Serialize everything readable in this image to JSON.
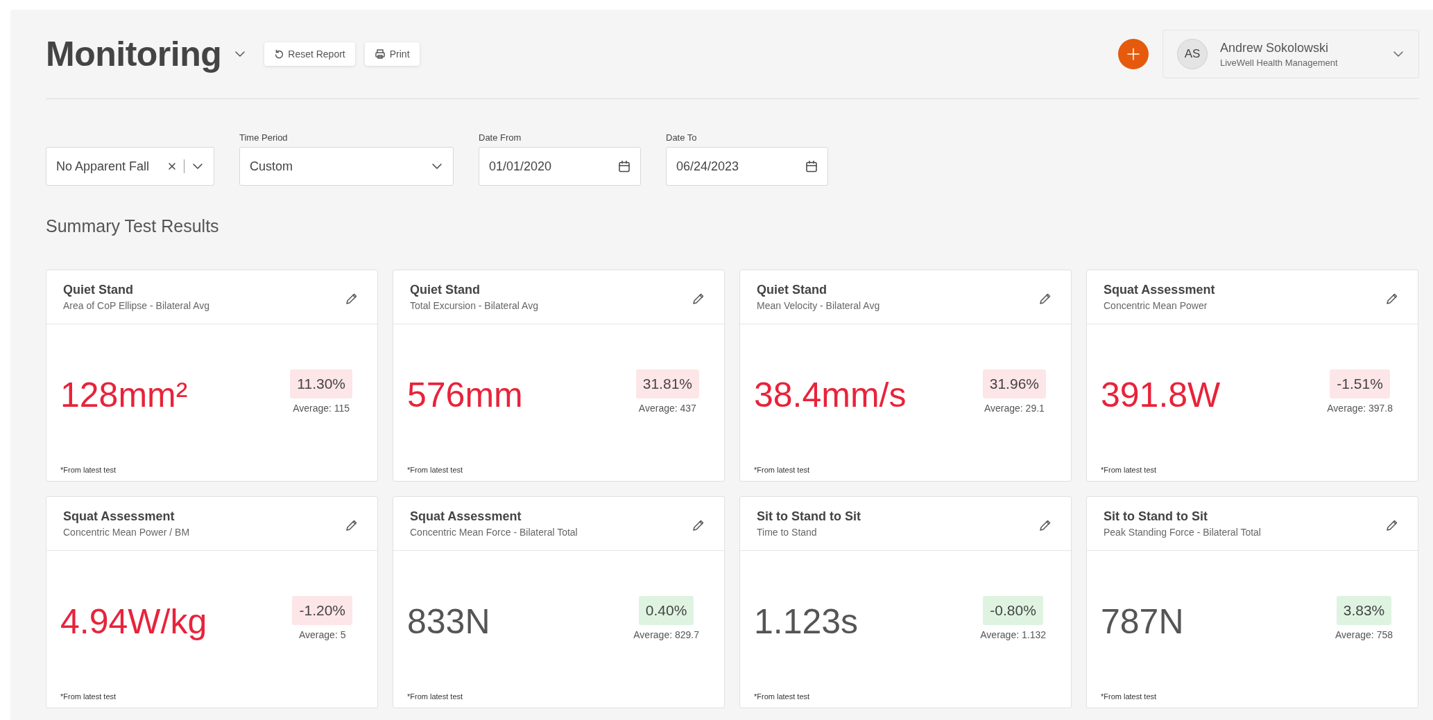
{
  "header": {
    "title": "Monitoring",
    "buttons": [
      {
        "kind": "reset",
        "label": "Reset Report"
      },
      {
        "kind": "print",
        "label": "Print"
      }
    ]
  },
  "user": {
    "initials": "AS",
    "name": "Andrew Sokolowski",
    "organization": "LiveWell Health Management"
  },
  "filters": [
    {
      "kind": "multi",
      "value": "No Apparent Fall"
    },
    {
      "kind": "select",
      "label": "Time Period",
      "value": "Custom"
    },
    {
      "kind": "date",
      "label": "Date From",
      "value": "01/01/2020"
    },
    {
      "kind": "date",
      "label": "Date To",
      "value": "06/24/2023"
    }
  ],
  "section_title": "Summary Test Results",
  "cards": [
    {
      "title": "Quiet Stand",
      "subtitle": "Area of CoP Ellipse - Bilateral Avg",
      "value": "128mm²",
      "change": "11.30%",
      "average": "Average: 115",
      "note": "*From latest test",
      "alert": true
    },
    {
      "title": "Quiet Stand",
      "subtitle": "Total Excursion - Bilateral Avg",
      "value": "576mm",
      "change": "31.81%",
      "average": "Average: 437",
      "note": "*From latest test",
      "alert": true
    },
    {
      "title": "Quiet Stand",
      "subtitle": "Mean Velocity - Bilateral Avg",
      "value": "38.4mm/s",
      "change": "31.96%",
      "average": "Average: 29.1",
      "note": "*From latest test",
      "alert": true
    },
    {
      "title": "Squat Assessment",
      "subtitle": "Concentric Mean Power",
      "value": "391.8W",
      "change": "-1.51%",
      "average": "Average: 397.8",
      "note": "*From latest test",
      "alert": true
    },
    {
      "title": "Squat Assessment",
      "subtitle": "Concentric Mean Power / BM",
      "value": "4.94W/kg",
      "change": "-1.20%",
      "average": "Average: 5",
      "note": "*From latest test",
      "alert": true
    },
    {
      "title": "Squat Assessment",
      "subtitle": "Concentric Mean Force - Bilateral Total",
      "value": "833N",
      "change": "0.40%",
      "average": "Average: 829.7",
      "note": "*From latest test",
      "alert": false
    },
    {
      "title": "Sit to Stand to Sit",
      "subtitle": "Time to Stand",
      "value": "1.123s",
      "change": "-0.80%",
      "average": "Average: 1.132",
      "note": "*From latest test",
      "alert": false
    },
    {
      "title": "Sit to Stand to Sit",
      "subtitle": "Peak Standing Force - Bilateral Total",
      "value": "787N",
      "change": "3.83%",
      "average": "Average: 758",
      "note": "*From latest test",
      "alert": false
    }
  ]
}
